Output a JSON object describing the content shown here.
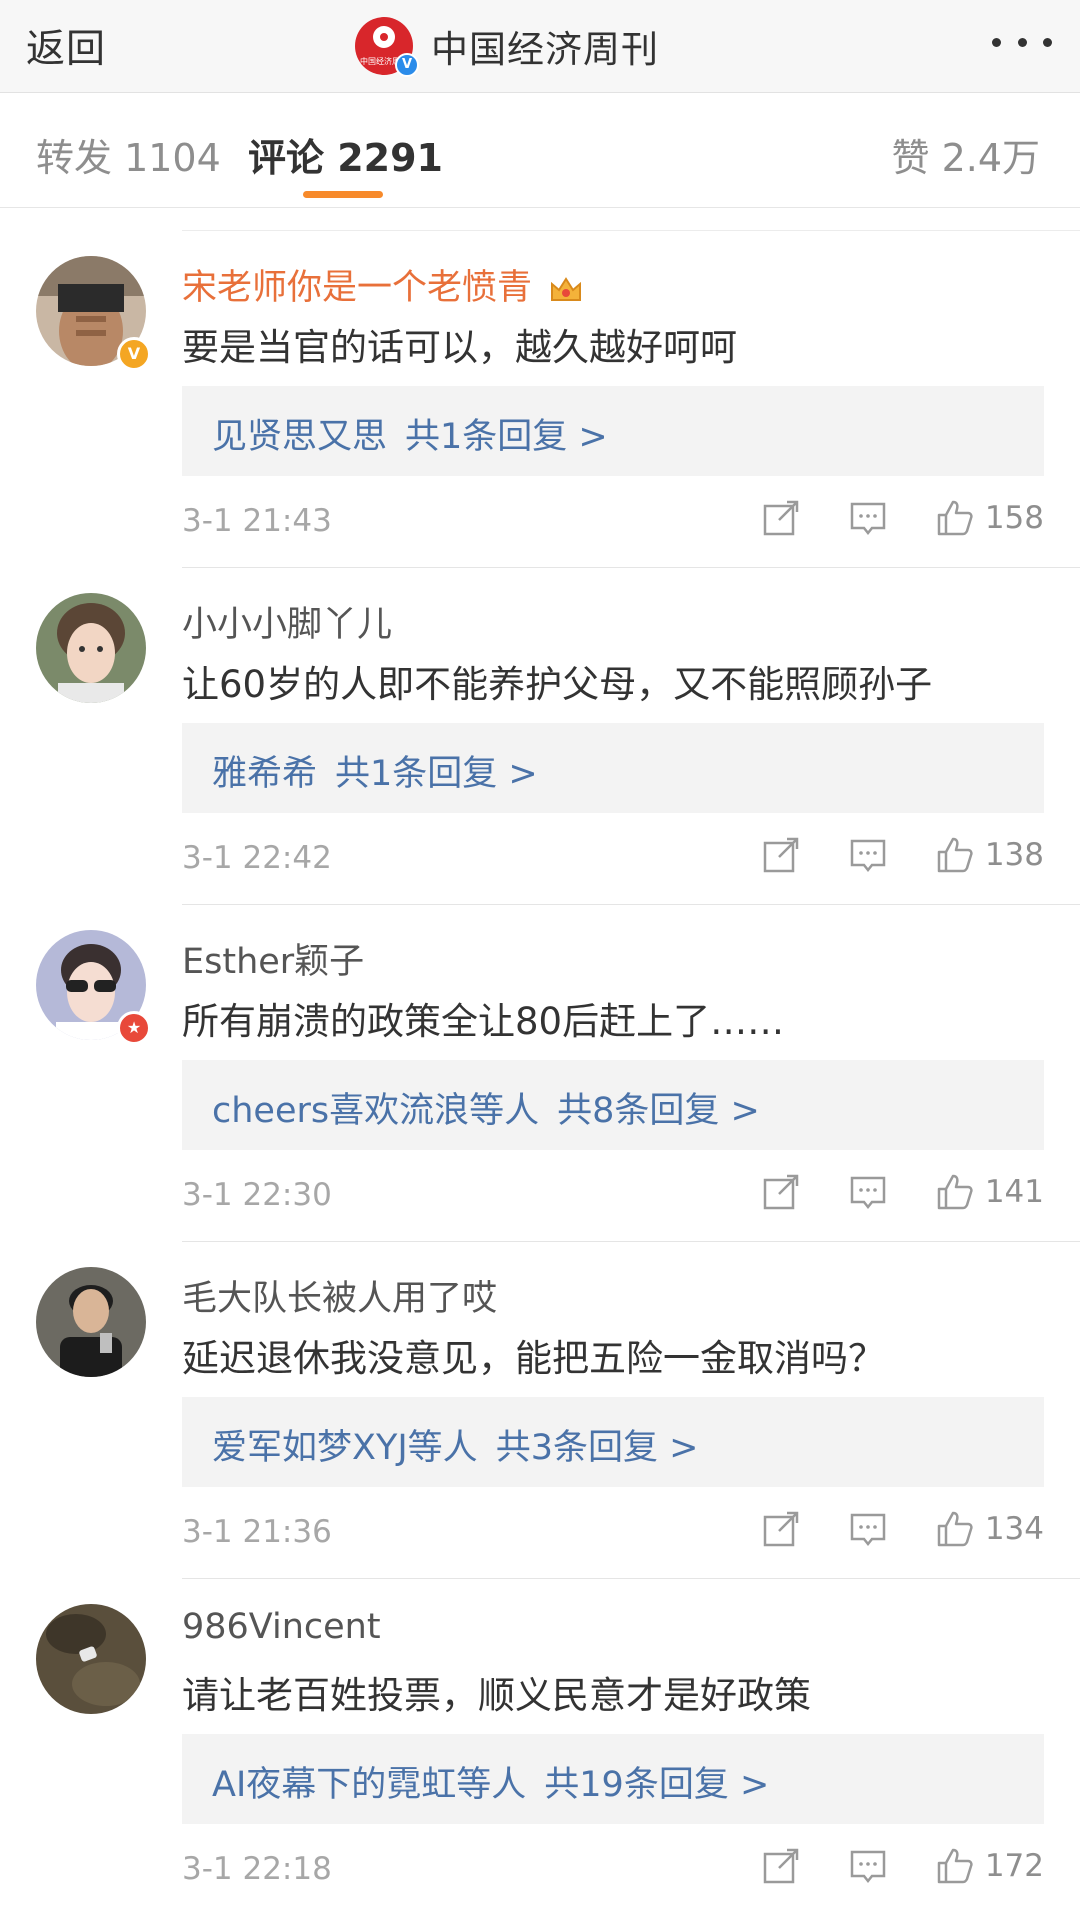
{
  "header": {
    "back_label": "返回",
    "logo_text": "中国经济周刊",
    "title": "中国经济周刊",
    "verified_mark": "V"
  },
  "tabs": {
    "forward": "转发 1104",
    "comment": "评论 2291",
    "like": "赞 2.4万"
  },
  "colors": {
    "accent_tab": "#f78a2b",
    "link_blue": "#4a72a8",
    "vip_name": "#e8703a"
  },
  "comments": [
    {
      "name": "宋老师你是一个老愤青",
      "text": "要是当官的话可以，越久越好呵呵",
      "reply_users": "见贤思又思",
      "reply_count": "共1条回复 >",
      "time": "3-1 21:43",
      "likes": "158",
      "avatar_badge": "V"
    },
    {
      "name": "小小小脚丫儿",
      "text": "让60岁的人即不能养护父母，又不能照顾孙子",
      "reply_users": "雅希希",
      "reply_count": "共1条回复 >",
      "time": "3-1 22:42",
      "likes": "138"
    },
    {
      "name": "Esther颖子",
      "text": "所有崩溃的政策全让80后赶上了……",
      "reply_users": "cheers喜欢流浪等人",
      "reply_count": "共8条回复 >",
      "time": "3-1 22:30",
      "likes": "141",
      "avatar_badge": "★"
    },
    {
      "name": "毛大队长被人用了哎",
      "text": "延迟退休我没意见，能把五险一金取消吗？",
      "reply_users": "爱军如梦XYJ等人",
      "reply_count": "共3条回复 >",
      "time": "3-1 21:36",
      "likes": "134"
    },
    {
      "name": "986Vincent",
      "text": "请让老百姓投票，顺义民意才是好政策",
      "reply_users": "AI夜幕下的霓虹等人",
      "reply_count": "共19条回复 >",
      "time": "3-1 22:18",
      "likes": "172"
    }
  ]
}
